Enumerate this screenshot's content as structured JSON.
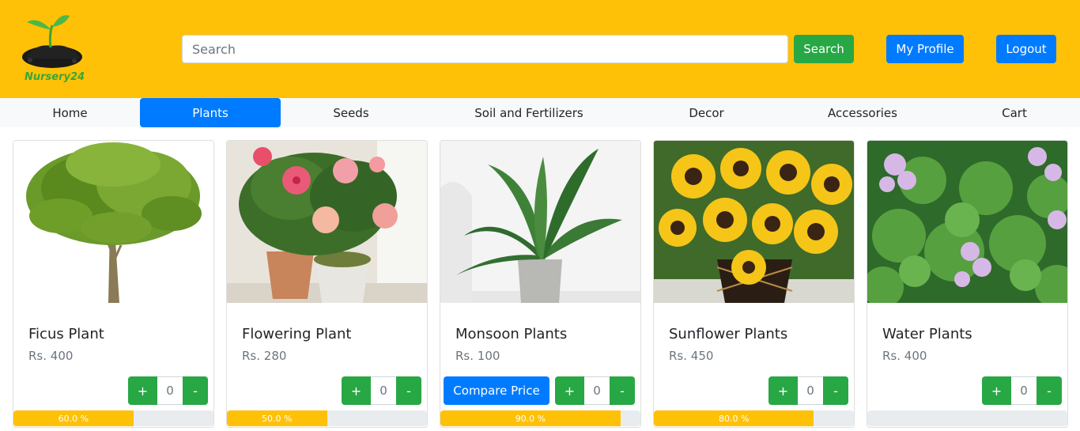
{
  "header": {
    "logo_text": "Nursery24",
    "search_placeholder": "Search",
    "search_value": "",
    "search_button": "Search",
    "profile_button": "My Profile",
    "logout_button": "Logout",
    "bg_color": "#ffc107"
  },
  "nav": {
    "items": [
      {
        "label": "Home",
        "active": false
      },
      {
        "label": "Plants",
        "active": true
      },
      {
        "label": "Seeds",
        "active": false
      },
      {
        "label": "Soil and Fertilizers",
        "active": false
      },
      {
        "label": "Decor",
        "active": false
      },
      {
        "label": "Accessories",
        "active": false
      },
      {
        "label": "Cart",
        "active": false
      }
    ]
  },
  "products": [
    {
      "name": "Ficus Plant",
      "price": "Rs. 400",
      "qty": "0",
      "progress_label": "60.0 %",
      "progress": 0.6,
      "compare": null,
      "image": "ficus-plant-image"
    },
    {
      "name": "Flowering Plant",
      "price": "Rs. 280",
      "qty": "0",
      "progress_label": "50.0 %",
      "progress": 0.5,
      "compare": null,
      "image": "flowering-plant-image"
    },
    {
      "name": "Monsoon Plants",
      "price": "Rs. 100",
      "qty": "0",
      "progress_label": "90.0 %",
      "progress": 0.9,
      "compare": "Compare Price",
      "image": "monsoon-plant-image"
    },
    {
      "name": "Sunflower Plants",
      "price": "Rs. 450",
      "qty": "0",
      "progress_label": "80.0 %",
      "progress": 0.8,
      "compare": null,
      "image": "sunflower-plant-image"
    },
    {
      "name": "Water Plants",
      "price": "Rs. 400",
      "qty": "0",
      "progress_label": "",
      "progress": 0,
      "compare": null,
      "image": "water-plant-image"
    }
  ],
  "qty_plus": "+",
  "qty_minus": "-"
}
